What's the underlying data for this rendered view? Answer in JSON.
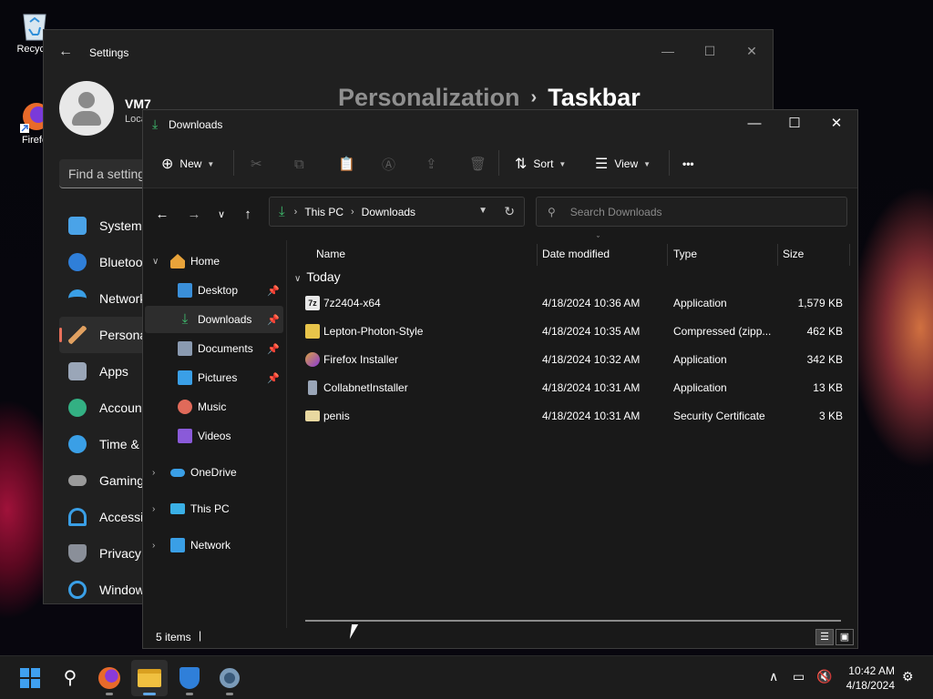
{
  "desktop": {
    "icons": [
      {
        "label": "Recycle",
        "icon": "recycle-bin-icon"
      },
      {
        "label": "Firefo",
        "icon": "firefox-icon"
      }
    ]
  },
  "settings": {
    "app_title": "Settings",
    "user_name": "VM7",
    "user_account": "Loca",
    "search_placeholder": "Find a setting",
    "breadcrumb_parent": "Personalization",
    "breadcrumb_separator": "›",
    "breadcrumb_current": "Taskbar",
    "nav": [
      {
        "label": "System",
        "icon": "system-icon",
        "color": "#4aa3e8"
      },
      {
        "label": "Bluetoo",
        "icon": "bluetooth-icon",
        "color": "#2f7fd9"
      },
      {
        "label": "Network",
        "icon": "wifi-icon",
        "color": "#3a9fe6"
      },
      {
        "label": "Persona",
        "icon": "brush-icon",
        "color": "#e0a060",
        "selected": true
      },
      {
        "label": "Apps",
        "icon": "apps-icon",
        "color": "#9aa6b8"
      },
      {
        "label": "Account",
        "icon": "account-icon",
        "color": "#33b083"
      },
      {
        "label": "Time &",
        "icon": "clock-globe-icon",
        "color": "#3a9fe6"
      },
      {
        "label": "Gaming",
        "icon": "gamepad-icon",
        "color": "#9a9a9a"
      },
      {
        "label": "Accessib",
        "icon": "accessibility-icon",
        "color": "#3a9fe6"
      },
      {
        "label": "Privacy",
        "icon": "shield-icon",
        "color": "#8a8f99"
      },
      {
        "label": "Window",
        "icon": "update-icon",
        "color": "#3a9fe6"
      }
    ]
  },
  "explorer": {
    "title": "Downloads",
    "commands": {
      "new_label": "New",
      "sort_label": "Sort",
      "view_label": "View",
      "more_label": "•••"
    },
    "address": {
      "segments": [
        "This PC",
        "Downloads"
      ],
      "separator": "›"
    },
    "search_placeholder": "Search Downloads",
    "nav_pane": [
      {
        "label": "Home",
        "icon": "home-icon",
        "color": "#e8a33a",
        "level": 0,
        "expanded": true
      },
      {
        "label": "Desktop",
        "icon": "desktop-icon",
        "color": "#3a8fd9",
        "level": 1,
        "pinned": true
      },
      {
        "label": "Downloads",
        "icon": "download-icon",
        "color": "#3fbf6f",
        "level": 1,
        "pinned": true,
        "selected": true
      },
      {
        "label": "Documents",
        "icon": "documents-icon",
        "color": "#8a9ab0",
        "level": 1,
        "pinned": true
      },
      {
        "label": "Pictures",
        "icon": "pictures-icon",
        "color": "#3a9fe6",
        "level": 1,
        "pinned": true
      },
      {
        "label": "Music",
        "icon": "music-icon",
        "color": "#e06a5a",
        "level": 1
      },
      {
        "label": "Videos",
        "icon": "videos-icon",
        "color": "#8a5ad9",
        "level": 1
      },
      {
        "label": "OneDrive",
        "icon": "cloud-icon",
        "color": "#3a9fe6",
        "level": 0,
        "collapsed": true
      },
      {
        "label": "This PC",
        "icon": "computer-icon",
        "color": "#3ab0e6",
        "level": 0,
        "collapsed": true
      },
      {
        "label": "Network",
        "icon": "network-icon",
        "color": "#3a9fe6",
        "level": 0,
        "collapsed": true
      }
    ],
    "columns": [
      "Name",
      "Date modified",
      "Type",
      "Size"
    ],
    "group_label": "Today",
    "files": [
      {
        "name": "7z2404-x64",
        "date": "4/18/2024 10:36 AM",
        "type": "Application",
        "size": "1,579 KB",
        "icon": "7zip-icon",
        "color": "#e8e8e8"
      },
      {
        "name": "Lepton-Photon-Style",
        "date": "4/18/2024 10:35 AM",
        "type": "Compressed (zipp...",
        "size": "462 KB",
        "icon": "zip-folder-icon",
        "color": "#e8c44a"
      },
      {
        "name": "Firefox Installer",
        "date": "4/18/2024 10:32 AM",
        "type": "Application",
        "size": "342 KB",
        "icon": "firefox-installer-icon",
        "color": "#d9a040"
      },
      {
        "name": "CollabnetInstaller",
        "date": "4/18/2024 10:31 AM",
        "type": "Application",
        "size": "13 KB",
        "icon": "installer-icon",
        "color": "#9aa6b8"
      },
      {
        "name": "penis",
        "date": "4/18/2024 10:31 AM",
        "type": "Security Certificate",
        "size": "3 KB",
        "icon": "certificate-icon",
        "color": "#e8d8a0"
      }
    ],
    "status": "5 items"
  },
  "taskbar": {
    "apps": [
      {
        "name": "start",
        "icon": "windows-start-icon"
      },
      {
        "name": "search",
        "icon": "search-icon"
      },
      {
        "name": "firefox",
        "icon": "firefox-icon",
        "running": true
      },
      {
        "name": "file-explorer",
        "icon": "folder-icon",
        "running": true,
        "active": true
      },
      {
        "name": "security",
        "icon": "shield-icon",
        "running": true
      },
      {
        "name": "settings",
        "icon": "gear-icon",
        "running": true
      }
    ],
    "clock_time": "10:42 AM",
    "clock_date": "4/18/2024"
  }
}
